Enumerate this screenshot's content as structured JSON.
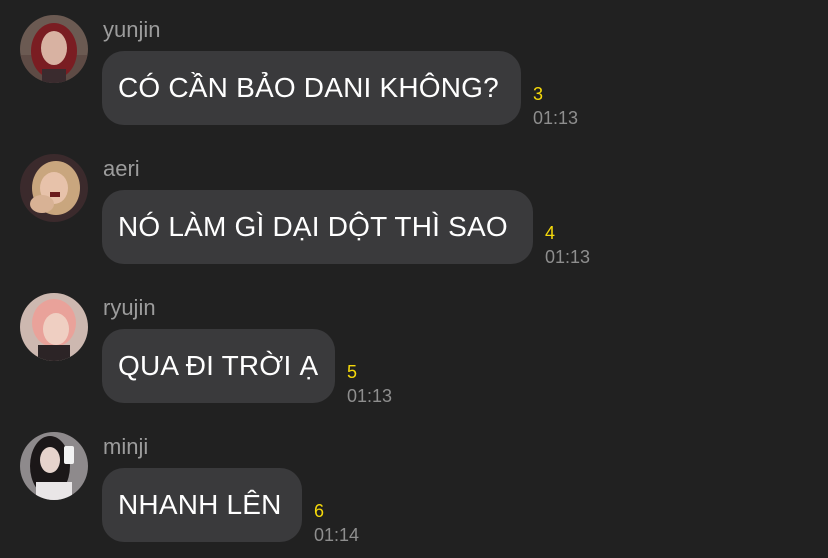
{
  "messages": [
    {
      "sender": "yunjin",
      "text": "CÓ CẦN BẢO DANI KHÔNG?",
      "unread": "3",
      "time": "01:13",
      "avatar_colors": {
        "bg": "#6b5a52",
        "hair": "#7a1d22",
        "face": "#d8b2a2"
      }
    },
    {
      "sender": "aeri",
      "text": "NÓ LÀM GÌ DẠI DỘT THÌ SAO",
      "unread": "4",
      "time": "01:13",
      "avatar_colors": {
        "bg": "#3b2a2c",
        "hair": "#c9a67e",
        "face": "#e7c2aa"
      }
    },
    {
      "sender": "ryujin",
      "text": "QUA ĐI TRỜI Ạ",
      "unread": "5",
      "time": "01:13",
      "avatar_colors": {
        "bg": "#cdb8b0",
        "hair": "#e9a29a",
        "face": "#efcfc2"
      }
    },
    {
      "sender": "minji",
      "text": "NHANH LÊN",
      "unread": "6",
      "time": "01:14",
      "avatar_colors": {
        "bg": "#8e8a8c",
        "hair": "#1b1718",
        "face": "#e6d3cc"
      }
    }
  ]
}
